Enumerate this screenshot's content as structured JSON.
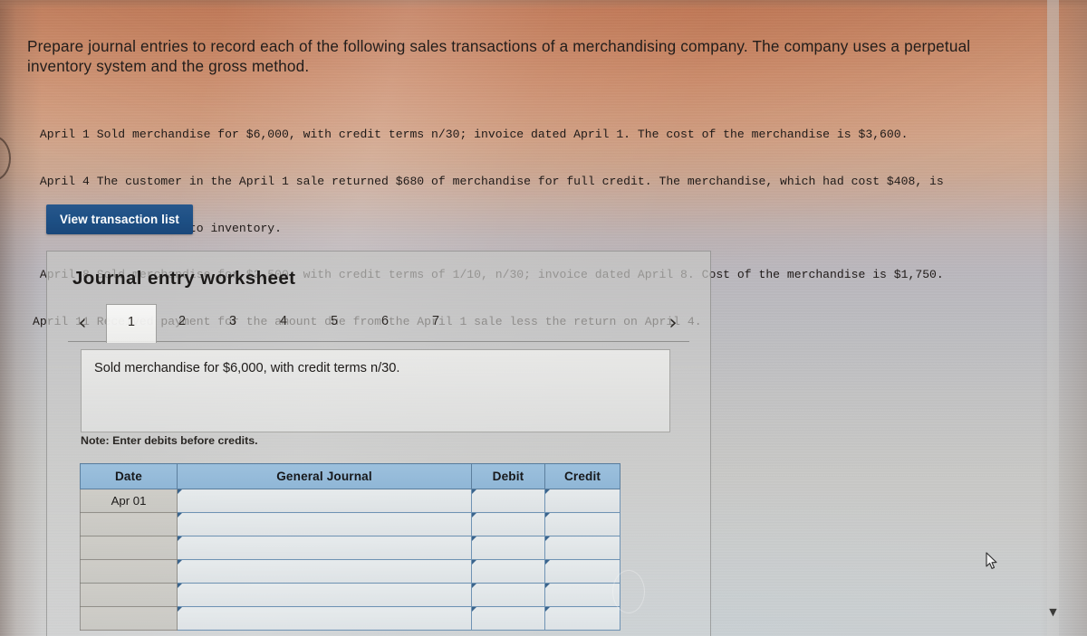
{
  "prompt": {
    "heading": "Prepare journal entries to record each of the following sales transactions of a merchandising company. The company uses a perpetual inventory system and the gross method."
  },
  "transactions": [
    {
      "date": "April 1",
      "text": "Sold merchandise for $6,000, with credit terms n/30; invoice dated April 1. The cost of the merchandise is $3,600.",
      "continuation": ""
    },
    {
      "date": "April 4",
      "text": "The customer in the April 1 sale returned $680 of merchandise for full credit. The merchandise, which had cost $408, is",
      "continuation": "returned to inventory."
    },
    {
      "date": "April 8",
      "text": "Sold merchandise for $2,500, with credit terms of 1/10, n/30; invoice dated April 8. Cost of the merchandise is $1,750.",
      "continuation": ""
    },
    {
      "date": "April 11",
      "text": "Received payment for the amount due from the April 1 sale less the return on April 4.",
      "continuation": ""
    }
  ],
  "toolbar": {
    "view_transaction_list_label": "View transaction list"
  },
  "worksheet": {
    "title": "Journal entry worksheet",
    "prev_arrow": "‹",
    "next_arrow": "›",
    "tabs": [
      {
        "label": "1",
        "active": true
      },
      {
        "label": "2",
        "active": false
      },
      {
        "label": "3",
        "active": false
      },
      {
        "label": "4",
        "active": false
      },
      {
        "label": "5",
        "active": false
      },
      {
        "label": "6",
        "active": false
      },
      {
        "label": "7",
        "active": false
      }
    ],
    "entry_prompt": "Sold merchandise for $6,000, with credit terms n/30.",
    "note": "Note: Enter debits before credits."
  },
  "journal_table": {
    "columns": [
      "Date",
      "General Journal",
      "Debit",
      "Credit"
    ],
    "rows": [
      {
        "date": "Apr 01",
        "general_journal": "",
        "debit": "",
        "credit": ""
      },
      {
        "date": "",
        "general_journal": "",
        "debit": "",
        "credit": ""
      },
      {
        "date": "",
        "general_journal": "",
        "debit": "",
        "credit": ""
      },
      {
        "date": "",
        "general_journal": "",
        "debit": "",
        "credit": ""
      },
      {
        "date": "",
        "general_journal": "",
        "debit": "",
        "credit": ""
      },
      {
        "date": "",
        "general_journal": "",
        "debit": "",
        "credit": ""
      }
    ]
  },
  "scrollbar": {
    "down_arrow": "▼"
  },
  "colors": {
    "button_blue": "#1d4f84",
    "table_header_blue": "#92b8d8",
    "input_cell_border": "#6f93b4",
    "date_cell_bg": "#cecbc4"
  }
}
